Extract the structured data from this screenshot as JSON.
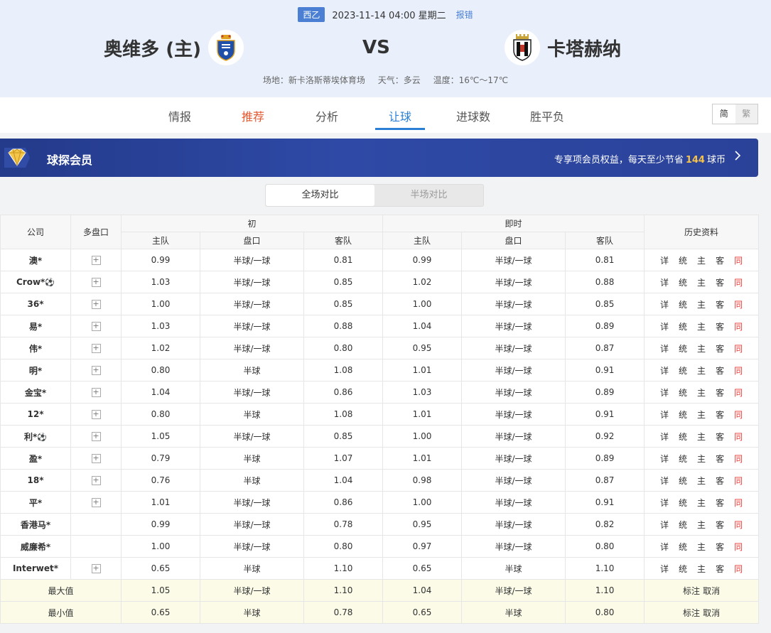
{
  "match": {
    "league": "西乙",
    "datetime": "2023-11-14 04:00 星期二",
    "report": "报错",
    "home": "奥维多 (主)",
    "away": "卡塔赫纳",
    "vs": "VS",
    "venue": "场地：新卡洛斯蒂埃体育场",
    "weather": "天气：多云",
    "temperature": "温度：16℃～17℃"
  },
  "nav": {
    "tabs": [
      "情报",
      "推荐",
      "分析",
      "让球",
      "进球数",
      "胜平负"
    ],
    "active": "让球",
    "lang_simplified": "简",
    "lang_traditional": "繁"
  },
  "member": {
    "title": "球探会员",
    "text_pre": "专享项会员权益，每天至少节省",
    "amount": "144",
    "text_post": "球币"
  },
  "toggle": {
    "full": "全场对比",
    "half": "半场对比"
  },
  "table": {
    "headers": {
      "company": "公司",
      "multi": "多盘口",
      "initial": "初",
      "live": "即时",
      "history": "历史资料",
      "home": "主队",
      "line": "盘口",
      "away": "客队"
    },
    "history_links": [
      "详",
      "统",
      "主",
      "客",
      "同"
    ],
    "rows": [
      {
        "company": "澳*",
        "ball": false,
        "multi": true,
        "i_home": "0.99",
        "i_line": "半球/一球",
        "i_away": "0.81",
        "l_home": "0.99",
        "l_line": "半球/一球",
        "l_away": "0.81"
      },
      {
        "company": "Crow*",
        "ball": true,
        "multi": true,
        "i_home": "1.03",
        "i_line": "半球/一球",
        "i_away": "0.85",
        "l_home": "1.02",
        "l_line": "半球/一球",
        "l_away": "0.88"
      },
      {
        "company": "36*",
        "ball": false,
        "multi": true,
        "i_home": "1.00",
        "i_line": "半球/一球",
        "i_away": "0.85",
        "l_home": "1.00",
        "l_line": "半球/一球",
        "l_away": "0.85"
      },
      {
        "company": "易*",
        "ball": false,
        "multi": true,
        "i_home": "1.03",
        "i_line": "半球/一球",
        "i_away": "0.88",
        "l_home": "1.04",
        "l_line": "半球/一球",
        "l_away": "0.89"
      },
      {
        "company": "伟*",
        "ball": false,
        "multi": true,
        "i_home": "1.02",
        "i_line": "半球/一球",
        "i_away": "0.80",
        "l_home": "0.95",
        "l_line": "半球/一球",
        "l_away": "0.87"
      },
      {
        "company": "明*",
        "ball": false,
        "multi": true,
        "i_home": "0.80",
        "i_line": "半球",
        "i_away": "1.08",
        "l_home": "1.01",
        "l_line": "半球/一球",
        "l_away": "0.91"
      },
      {
        "company": "金宝*",
        "ball": false,
        "multi": true,
        "i_home": "1.04",
        "i_line": "半球/一球",
        "i_away": "0.86",
        "l_home": "1.03",
        "l_line": "半球/一球",
        "l_away": "0.89"
      },
      {
        "company": "12*",
        "ball": false,
        "multi": true,
        "i_home": "0.80",
        "i_line": "半球",
        "i_away": "1.08",
        "l_home": "1.01",
        "l_line": "半球/一球",
        "l_away": "0.91"
      },
      {
        "company": "利*",
        "ball": true,
        "multi": true,
        "i_home": "1.05",
        "i_line": "半球/一球",
        "i_away": "0.85",
        "l_home": "1.00",
        "l_line": "半球/一球",
        "l_away": "0.92"
      },
      {
        "company": "盈*",
        "ball": false,
        "multi": true,
        "i_home": "0.79",
        "i_line": "半球",
        "i_away": "1.07",
        "l_home": "1.01",
        "l_line": "半球/一球",
        "l_away": "0.89"
      },
      {
        "company": "18*",
        "ball": false,
        "multi": true,
        "i_home": "0.76",
        "i_line": "半球",
        "i_away": "1.04",
        "l_home": "0.98",
        "l_line": "半球/一球",
        "l_away": "0.87"
      },
      {
        "company": "平*",
        "ball": false,
        "multi": true,
        "i_home": "1.01",
        "i_line": "半球/一球",
        "i_away": "0.86",
        "l_home": "1.00",
        "l_line": "半球/一球",
        "l_away": "0.91"
      },
      {
        "company": "香港马*",
        "ball": false,
        "multi": false,
        "i_home": "0.99",
        "i_line": "半球/一球",
        "i_away": "0.78",
        "l_home": "0.95",
        "l_line": "半球/一球",
        "l_away": "0.82"
      },
      {
        "company": "威廉希*",
        "ball": false,
        "multi": false,
        "i_home": "1.00",
        "i_line": "半球/一球",
        "i_away": "0.80",
        "l_home": "0.97",
        "l_line": "半球/一球",
        "l_away": "0.80"
      },
      {
        "company": "Interwet*",
        "ball": false,
        "multi": true,
        "i_home": "0.65",
        "i_line": "半球",
        "i_away": "1.10",
        "l_home": "0.65",
        "l_line": "半球",
        "l_away": "1.10"
      }
    ],
    "summary": [
      {
        "label": "最大值",
        "i_home": "1.05",
        "i_line": "半球/一球",
        "i_away": "1.10",
        "l_home": "1.04",
        "l_line": "半球/一球",
        "l_away": "1.10"
      },
      {
        "label": "最小值",
        "i_home": "0.65",
        "i_line": "半球",
        "i_away": "0.78",
        "l_home": "0.65",
        "l_line": "半球",
        "l_away": "0.80"
      }
    ],
    "mark": "标注",
    "cancel": "取消"
  },
  "colors": {
    "accent": "#2a7fd4",
    "recommend": "#e4572e",
    "same_link": "#e53935",
    "gold": "#f6c34a"
  }
}
